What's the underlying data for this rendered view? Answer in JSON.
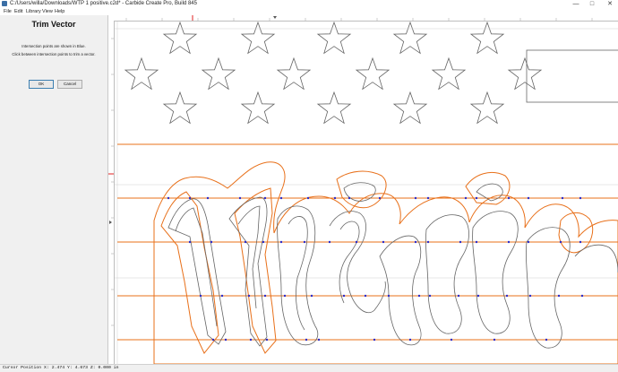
{
  "window": {
    "title": "C:/Users/willa/Downloads/WTP 1 positive.c2d* - Carbide Create Pro, Build 845",
    "minimize_glyph": "—",
    "maximize_glyph": "□",
    "close_glyph": "✕"
  },
  "menu": {
    "items": [
      "File",
      "Edit",
      "Library",
      "View",
      "Help"
    ]
  },
  "panel": {
    "title": "Trim Vector",
    "instruction_1": "Intersection points are shown in Blue.",
    "instruction_2": "Click between intersection points to trim a vector.",
    "ok_label": "OK",
    "cancel_label": "Cancel"
  },
  "canvas": {
    "icons": [
      "star-icon"
    ],
    "colors": {
      "vector": "#666666",
      "selected_vector": "#e8701a",
      "intersection_point": "#2b2bc8",
      "canvas_bg": "#ffffff",
      "ruler_marker": "#e02020"
    }
  },
  "status": {
    "cursor_position": "Cursor Position X: 2.474 Y: 4.673 Z: 0.000 in"
  }
}
